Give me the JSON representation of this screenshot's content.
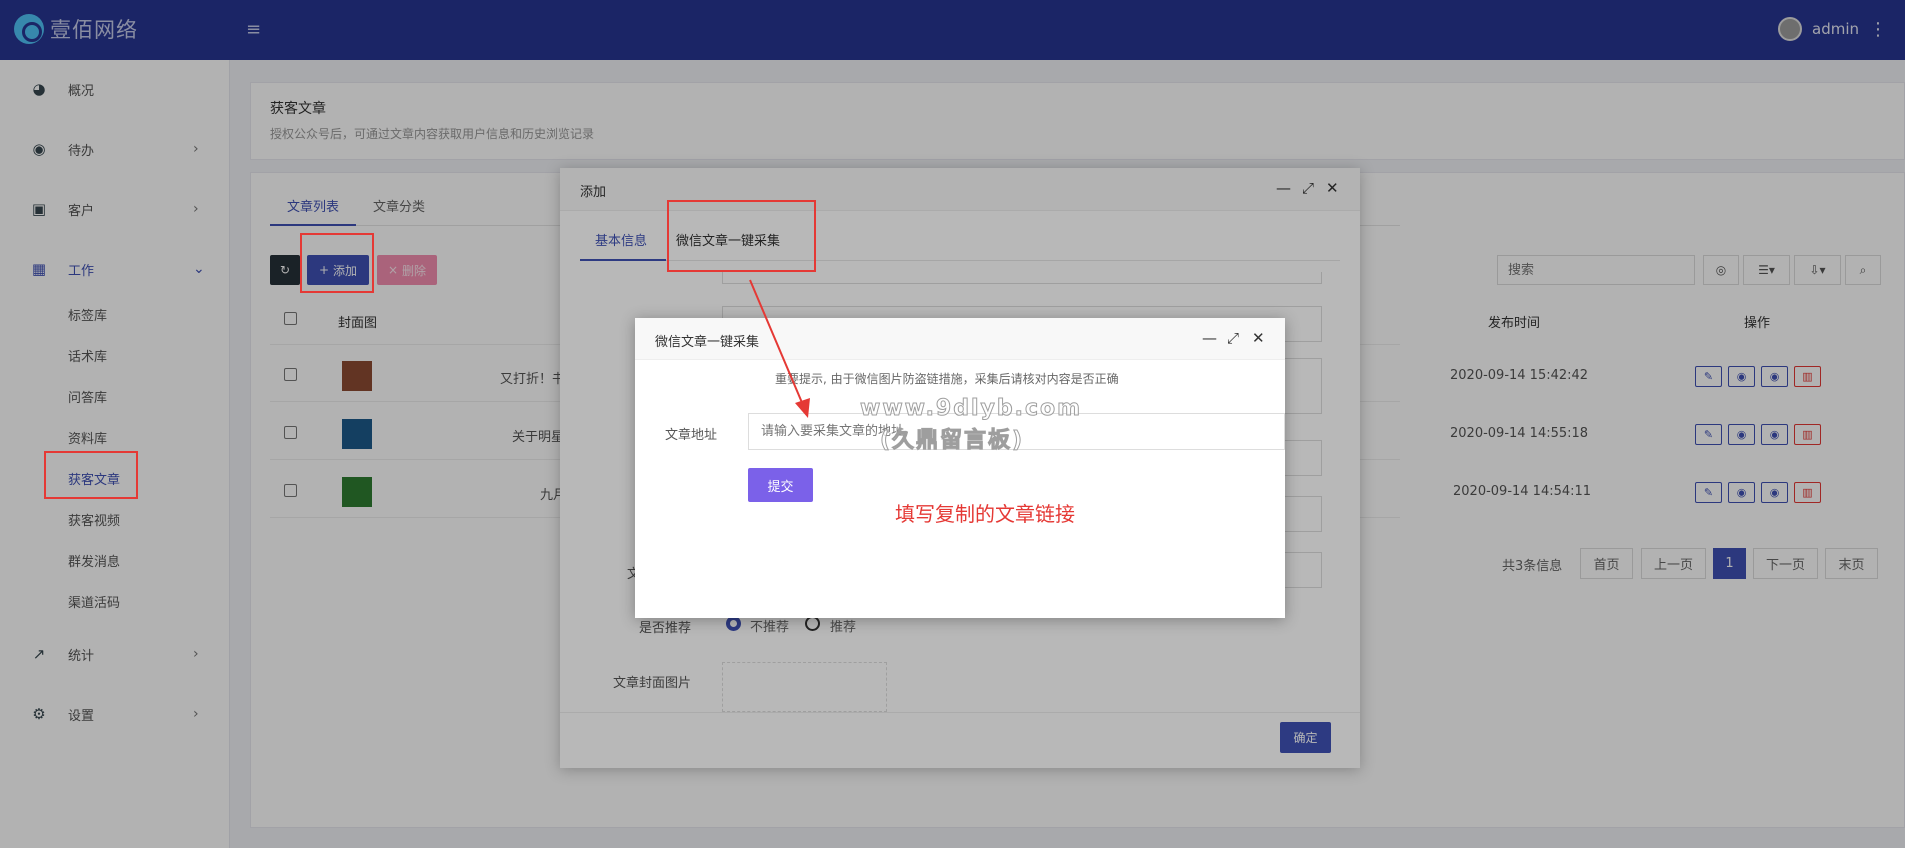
{
  "app": {
    "brand": "壹佰网络",
    "menu_icon": "hamburger-icon",
    "user": "admin",
    "more_icon": "kebab-icon"
  },
  "sidebar": {
    "items": [
      {
        "label": "概况",
        "icon": "dashboard-icon"
      },
      {
        "label": "待办",
        "icon": "compass-icon"
      },
      {
        "label": "客户",
        "icon": "contact-card-icon"
      },
      {
        "label": "工作",
        "icon": "grid-icon"
      },
      {
        "label": "统计",
        "icon": "line-chart-icon"
      },
      {
        "label": "设置",
        "icon": "gear-icon"
      }
    ],
    "sub_items": [
      "标签库",
      "话术库",
      "问答库",
      "资料库",
      "获客文章",
      "获客视频",
      "群发消息",
      "渠道活码"
    ],
    "active_sub": "获客文章"
  },
  "page": {
    "title": "获客文章",
    "description": "授权公众号后，可通过文章内容获取用户信息和历史浏览记录",
    "tabs": [
      "文章列表",
      "文章分类"
    ],
    "toolbar": {
      "add": "添加",
      "delete": "删除"
    },
    "search_placeholder": "搜索",
    "table": {
      "headers": [
        "封面图",
        "发布时间",
        "操作"
      ],
      "rows": [
        {
          "title_fragment": "又打折！书",
          "time": "2020-09-14 15:42:42"
        },
        {
          "title_fragment": "关于明星",
          "time": "2020-09-14 14:55:18"
        },
        {
          "title_fragment": "九月",
          "time": "2020-09-14 14:54:11"
        }
      ]
    },
    "pager": {
      "info": "共3条信息",
      "first": "首页",
      "prev": "上一页",
      "current": "1",
      "next": "下一页",
      "last": "末页"
    }
  },
  "add_dialog": {
    "title": "添加",
    "tabs": [
      "基本信息",
      "微信文章一键采集"
    ],
    "labels": {
      "partial": "文",
      "recommend": "是否推荐",
      "cover": "文章封面图片"
    },
    "radio": [
      "不推荐",
      "推荐"
    ],
    "ok": "确定"
  },
  "collect_dialog": {
    "title": "微信文章一键采集",
    "tip": "重要提示, 由于微信图片防盗链措施，采集后请核对内容是否正确",
    "url_label": "文章地址",
    "url_placeholder": "请输入要采集文章的地址",
    "submit": "提交"
  },
  "annotation": {
    "hint": "填写复制的文章链接"
  },
  "watermark": {
    "line1": "www.9dlyb.com",
    "line2": "(久鼎留言板)"
  },
  "colors": {
    "topbar": "#283593",
    "accent": "#3f51b5",
    "annotation": "#e53935",
    "submit": "#7b61e9"
  }
}
